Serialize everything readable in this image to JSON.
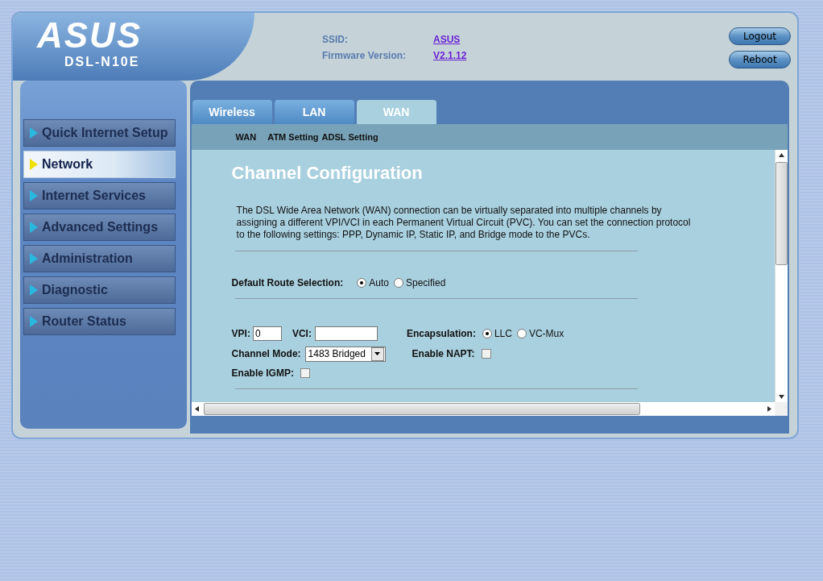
{
  "header": {
    "logo": "ASUS",
    "model": "DSL-N10E",
    "info": [
      {
        "label": "SSID:",
        "value": "ASUS"
      },
      {
        "label": "Firmware Version:",
        "value": "V2.1.12"
      }
    ],
    "buttons": [
      "Logout",
      "Reboot"
    ]
  },
  "sidebar": {
    "items": [
      {
        "label": "Quick Internet Setup",
        "selected": false
      },
      {
        "label": "Network",
        "selected": true
      },
      {
        "label": "Internet Services",
        "selected": false
      },
      {
        "label": "Advanced Settings",
        "selected": false
      },
      {
        "label": "Administration",
        "selected": false
      },
      {
        "label": "Diagnostic",
        "selected": false
      },
      {
        "label": "Router Status",
        "selected": false
      }
    ]
  },
  "tabs": [
    {
      "label": "Wireless",
      "selected": false
    },
    {
      "label": "LAN",
      "selected": false
    },
    {
      "label": "WAN",
      "selected": true
    }
  ],
  "subtabs": [
    "WAN",
    "ATM Setting",
    "ADSL Setting"
  ],
  "content": {
    "title": "Channel Configuration",
    "description": "The DSL Wide Area Network (WAN) connection can be virtually separated into multiple channels by assigning a different VPI/VCI in each Permanent Virtual Circuit (PVC). You can set the connection protocol to the following settings: PPP, Dynamic IP, Static IP, and Bridge mode to the PVCs.",
    "default_route": {
      "label": "Default Route Selection:",
      "options": [
        {
          "label": "Auto",
          "selected": true
        },
        {
          "label": "Specified",
          "selected": false
        }
      ]
    },
    "vpi": {
      "label": "VPI:",
      "value": "0"
    },
    "vci": {
      "label": "VCI:"
    },
    "encapsulation": {
      "label": "Encapsulation:",
      "options": [
        {
          "label": "LLC",
          "selected": true
        },
        {
          "label": "VC-Mux",
          "selected": false
        }
      ]
    },
    "channel_mode": {
      "label": "Channel Mode:",
      "value": "1483 Bridged"
    },
    "enable_napt": {
      "label": "Enable NAPT:",
      "checked": false
    },
    "enable_igmp": {
      "label": "Enable IGMP:",
      "checked": false
    }
  }
}
